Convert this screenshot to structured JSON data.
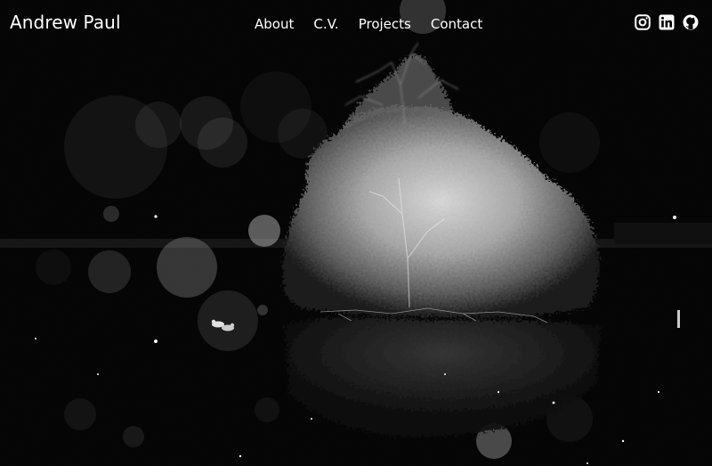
{
  "header": {
    "site_title": "Andrew Paul",
    "nav": [
      {
        "label": "About"
      },
      {
        "label": "C.V."
      },
      {
        "label": "Projects"
      },
      {
        "label": "Contact"
      }
    ],
    "social": [
      {
        "icon": "instagram-icon"
      },
      {
        "icon": "linkedin-icon"
      },
      {
        "icon": "github-icon"
      }
    ]
  },
  "colors": {
    "text": "#ffffff",
    "background": "#000000"
  }
}
